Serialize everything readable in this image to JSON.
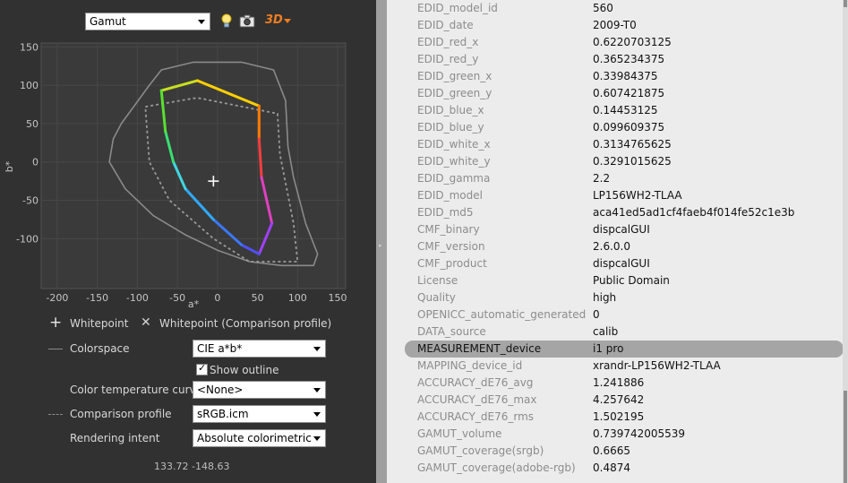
{
  "toolbar": {
    "view_select": "Gamut",
    "icons": [
      "lightbulb-icon",
      "camera-icon",
      "3d-icon"
    ],
    "label_3d": "3D"
  },
  "chart_data": {
    "type": "scatter",
    "xlabel": "a*",
    "ylabel": "b*",
    "xlim": [
      -220,
      160
    ],
    "ylim": [
      -165,
      155
    ],
    "xticks": [
      "-200",
      "-150",
      "-100",
      "-50",
      "0",
      "50",
      "100",
      "150"
    ],
    "yticks": [
      "150",
      "100",
      "50",
      "0",
      "-50",
      "-100"
    ],
    "grid": true,
    "series": [
      {
        "values": [
          [
            -70,
            93
          ],
          [
            -25,
            106
          ],
          [
            52,
            73
          ],
          [
            52,
            30
          ],
          [
            55,
            -20
          ],
          [
            68,
            -80
          ],
          [
            52,
            -120
          ],
          [
            30,
            -108
          ],
          [
            -5,
            -75
          ],
          [
            -40,
            -35
          ],
          [
            -55,
            0
          ],
          [
            -65,
            40
          ],
          [
            -70,
            93
          ]
        ]
      },
      {
        "values": [
          [
            -90,
            72
          ],
          [
            -30,
            83
          ],
          [
            -22,
            83
          ],
          [
            75,
            63
          ],
          [
            78,
            10
          ],
          [
            95,
            -80
          ],
          [
            100,
            -130
          ],
          [
            40,
            -130
          ],
          [
            -5,
            -100
          ],
          [
            -60,
            -50
          ],
          [
            -85,
            0
          ],
          [
            -90,
            72
          ]
        ]
      },
      {
        "values": [
          [
            -120,
            50
          ],
          [
            -85,
            100
          ],
          [
            -70,
            120
          ],
          [
            -30,
            130
          ],
          [
            30,
            130
          ],
          [
            70,
            120
          ],
          [
            85,
            80
          ],
          [
            88,
            20
          ],
          [
            95,
            -20
          ],
          [
            110,
            -80
          ],
          [
            125,
            -120
          ],
          [
            120,
            -135
          ],
          [
            80,
            -135
          ],
          [
            40,
            -130
          ],
          [
            0,
            -115
          ],
          [
            -40,
            -95
          ],
          [
            -80,
            -70
          ],
          [
            -115,
            -35
          ],
          [
            -135,
            0
          ],
          [
            -130,
            30
          ],
          [
            -120,
            50
          ]
        ]
      }
    ],
    "whitepoint": [
      -5,
      -25
    ]
  },
  "legend": {
    "whitepoint": "Whitepoint",
    "whitepoint_comparison": "Whitepoint (Comparison profile)"
  },
  "options": {
    "colorspace_label": "Colorspace",
    "colorspace_value": "CIE a*b*",
    "show_outline_label": "Show outline",
    "show_outline_checked": true,
    "color_temp_label": "Color temperature curve",
    "color_temp_value": "<None>",
    "comparison_label": "Comparison profile",
    "comparison_value": "sRGB.icm",
    "intent_label": "Rendering intent",
    "intent_value": "Absolute colorimetric"
  },
  "coords_readout": "133.72 -148.63",
  "properties": [
    {
      "key": "EDID_model_id",
      "value": "560"
    },
    {
      "key": "EDID_date",
      "value": "2009-T0"
    },
    {
      "key": "EDID_red_x",
      "value": "0.6220703125"
    },
    {
      "key": "EDID_red_y",
      "value": "0.365234375"
    },
    {
      "key": "EDID_green_x",
      "value": "0.33984375"
    },
    {
      "key": "EDID_green_y",
      "value": "0.607421875"
    },
    {
      "key": "EDID_blue_x",
      "value": "0.14453125"
    },
    {
      "key": "EDID_blue_y",
      "value": "0.099609375"
    },
    {
      "key": "EDID_white_x",
      "value": "0.3134765625"
    },
    {
      "key": "EDID_white_y",
      "value": "0.3291015625"
    },
    {
      "key": "EDID_gamma",
      "value": "2.2"
    },
    {
      "key": "EDID_model",
      "value": "LP156WH2-TLAA"
    },
    {
      "key": "EDID_md5",
      "value": "aca41ed5ad1cf4faeb4f014fe52c1e3b"
    },
    {
      "key": "CMF_binary",
      "value": "dispcalGUI"
    },
    {
      "key": "CMF_version",
      "value": "2.6.0.0"
    },
    {
      "key": "CMF_product",
      "value": "dispcalGUI"
    },
    {
      "key": "License",
      "value": "Public Domain"
    },
    {
      "key": "Quality",
      "value": "high"
    },
    {
      "key": "OPENICC_automatic_generated",
      "value": "0"
    },
    {
      "key": "DATA_source",
      "value": "calib"
    },
    {
      "key": "MEASUREMENT_device",
      "value": "i1 pro",
      "selected": true
    },
    {
      "key": "MAPPING_device_id",
      "value": "xrandr-LP156WH2-TLAA"
    },
    {
      "key": "ACCURACY_dE76_avg",
      "value": "1.241886"
    },
    {
      "key": "ACCURACY_dE76_max",
      "value": "4.257642"
    },
    {
      "key": "ACCURACY_dE76_rms",
      "value": "1.502195"
    },
    {
      "key": "GAMUT_volume",
      "value": "0.739742005539"
    },
    {
      "key": "GAMUT_coverage(srgb)",
      "value": "0.6665"
    },
    {
      "key": "GAMUT_coverage(adobe-rgb)",
      "value": "0.4874"
    }
  ]
}
